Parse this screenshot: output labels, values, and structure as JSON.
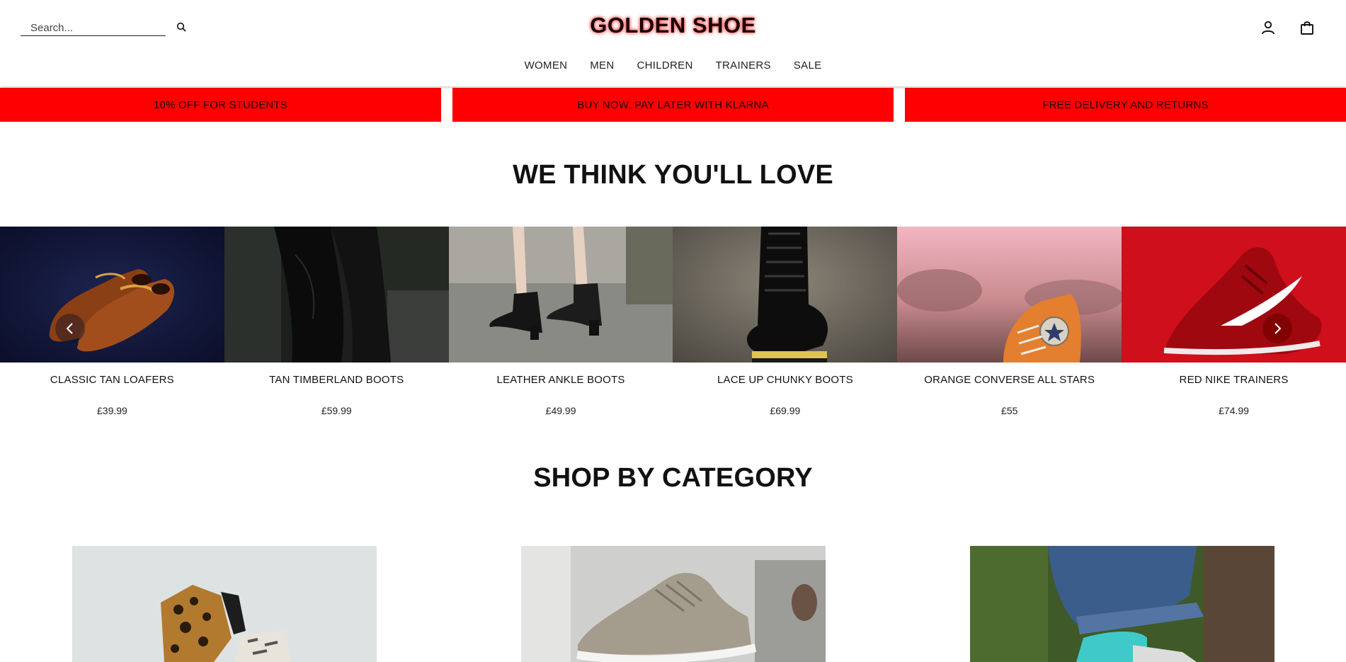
{
  "header": {
    "logo": "GOLDEN SHOE",
    "search_placeholder": "Search...",
    "search_value": "",
    "icons": {
      "search": "search-icon",
      "account": "user-icon",
      "cart": "shopping-bag-icon"
    },
    "nav": [
      "WOMEN",
      "MEN",
      "CHILDREN",
      "TRAINERS",
      "SALE"
    ]
  },
  "promos": [
    "10% OFF FOR STUDENTS",
    "BUY NOW, PAY LATER WITH KLARNA",
    "FREE DELIVERY AND RETURNS"
  ],
  "colors": {
    "promo_bg": "#ff0000",
    "logo_glow": "#ff4d4d",
    "text": "#111111"
  },
  "recommended": {
    "title": "WE THINK YOU'LL LOVE",
    "prev_icon": "chevron-left-icon",
    "next_icon": "chevron-right-icon",
    "products": [
      {
        "name": "CLASSIC TAN LOAFERS",
        "price": "£39.99"
      },
      {
        "name": "TAN TIMBERLAND BOOTS",
        "price": "£59.99"
      },
      {
        "name": "LEATHER ANKLE BOOTS",
        "price": "£49.99"
      },
      {
        "name": "LACE UP CHUNKY BOOTS",
        "price": "£69.99"
      },
      {
        "name": "ORANGE CONVERSE ALL STARS",
        "price": "£55"
      },
      {
        "name": "RED NIKE TRAINERS",
        "price": "£74.99"
      }
    ]
  },
  "categories": {
    "title": "SHOP BY CATEGORY",
    "items": [
      "women-category-image",
      "trainers-category-image",
      "children-category-image"
    ]
  }
}
